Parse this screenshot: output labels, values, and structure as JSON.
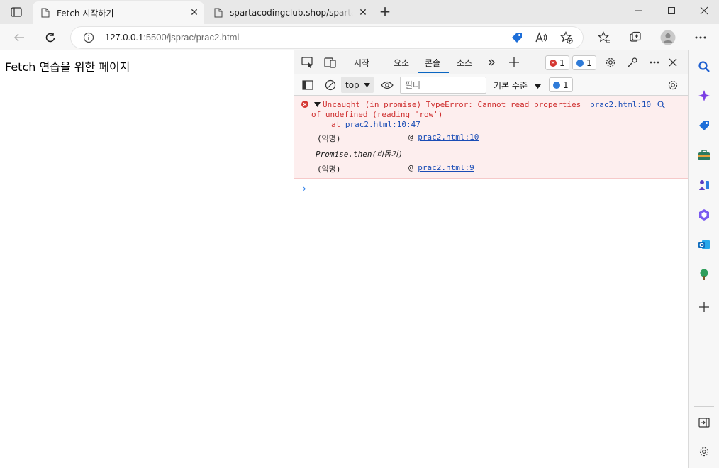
{
  "browser": {
    "tabs": [
      {
        "title": "Fetch 시작하기",
        "active": true
      },
      {
        "title": "spartacodingclub.shop/sparta_api",
        "active": false
      }
    ],
    "new_tab_label": "+",
    "address": {
      "host": "127.0.0.1",
      "rest": ":5500/jsprac/prac2.html"
    }
  },
  "page": {
    "heading": "Fetch 연습을 위한 페이지"
  },
  "devtools": {
    "tabs": [
      "시작",
      "요소",
      "콘솔",
      "소스"
    ],
    "active_tab": "콘솔",
    "error_count": "1",
    "message_count": "1",
    "context": "top",
    "filter_placeholder": "필터",
    "level_label": "기본 수준",
    "level_badge_count": "1",
    "error": {
      "line1": "Uncaught (in promise) TypeError: Cannot read properties",
      "line2": "of undefined (reading 'row')",
      "at_prefix": "at ",
      "at_link": "prac2.html:10:47",
      "source_link": "prac2.html:10",
      "stack": [
        {
          "fn": "(익명)",
          "at": "@ ",
          "link": "prac2.html:10"
        },
        {
          "fn": "Promise.then(비동기)",
          "italic": true
        },
        {
          "fn": "(익명)",
          "at": "@ ",
          "link": "prac2.html:9"
        }
      ]
    },
    "prompt": "›"
  },
  "colors": {
    "error_red": "#cf2f2f",
    "link_blue": "#1a4db6",
    "error_bg": "#fdeeee",
    "accent": "#0a66c2"
  }
}
